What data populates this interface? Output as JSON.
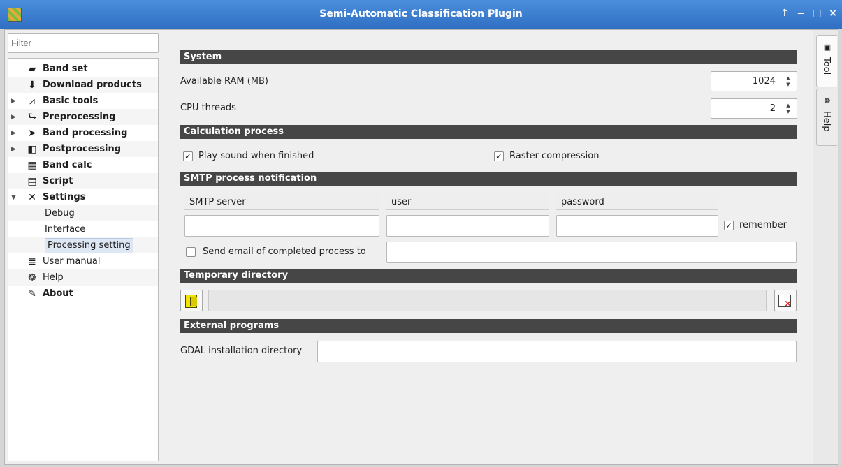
{
  "window": {
    "title": "Semi-Automatic Classification Plugin",
    "controls": [
      "↑",
      "‒",
      "□",
      "×"
    ]
  },
  "sidebar": {
    "filter_placeholder": "Filter",
    "items": [
      {
        "label": "Band set",
        "bold": true,
        "icon": "layers-icon",
        "glyph": "▰"
      },
      {
        "label": "Download products",
        "bold": true,
        "icon": "download-icon",
        "glyph": "⬇"
      },
      {
        "label": "Basic tools",
        "bold": true,
        "icon": "chart-icon",
        "glyph": "⩘",
        "collapsed": true
      },
      {
        "label": "Preprocessing",
        "bold": true,
        "icon": "preprocess-icon",
        "glyph": "⮑",
        "collapsed": true
      },
      {
        "label": "Band processing",
        "bold": true,
        "icon": "band-processing-icon",
        "glyph": "➤",
        "collapsed": true
      },
      {
        "label": "Postprocessing",
        "bold": true,
        "icon": "postprocess-icon",
        "glyph": "◧",
        "collapsed": true
      },
      {
        "label": "Band calc",
        "bold": true,
        "icon": "calculator-icon",
        "glyph": "▦"
      },
      {
        "label": "Script",
        "bold": true,
        "icon": "script-icon",
        "glyph": "▤"
      },
      {
        "label": "Settings",
        "bold": true,
        "icon": "wrench-icon",
        "glyph": "✕",
        "expanded": true
      },
      {
        "label": "Debug",
        "bold": false,
        "child": true
      },
      {
        "label": "Interface",
        "bold": false,
        "child": true
      },
      {
        "label": "Processing setting",
        "bold": false,
        "child": true,
        "selected": true
      },
      {
        "label": "User manual",
        "bold": false,
        "icon": "book-icon",
        "glyph": "≣"
      },
      {
        "label": "Help",
        "bold": false,
        "icon": "help-icon",
        "glyph": "☸"
      },
      {
        "label": "About",
        "bold": true,
        "icon": "pencil-icon",
        "glyph": "✎"
      }
    ]
  },
  "system": {
    "header": "System",
    "ram_label": "Available RAM (MB)",
    "ram_value": "1024",
    "cpu_label": "CPU threads",
    "cpu_value": "2"
  },
  "calculation": {
    "header": "Calculation process",
    "play_sound_label": "Play sound when finished",
    "play_sound_checked": true,
    "raster_compression_label": "Raster compression",
    "raster_compression_checked": true
  },
  "smtp": {
    "header": "SMTP process notification",
    "server_label": "SMTP server",
    "user_label": "user",
    "password_label": "password",
    "server_value": "",
    "user_value": "",
    "password_value": "",
    "remember_label": "remember",
    "remember_checked": true,
    "send_email_label": "Send email of completed process to",
    "send_email_checked": false,
    "email_value": ""
  },
  "temp_dir": {
    "header": "Temporary directory",
    "path_value": ""
  },
  "external": {
    "header": "External programs",
    "gdal_label": "GDAL installation directory",
    "gdal_value": ""
  },
  "dock_tabs": [
    "Tool",
    "Help"
  ],
  "check_mark": "✓",
  "spin_up": "▲",
  "spin_down": "▼"
}
